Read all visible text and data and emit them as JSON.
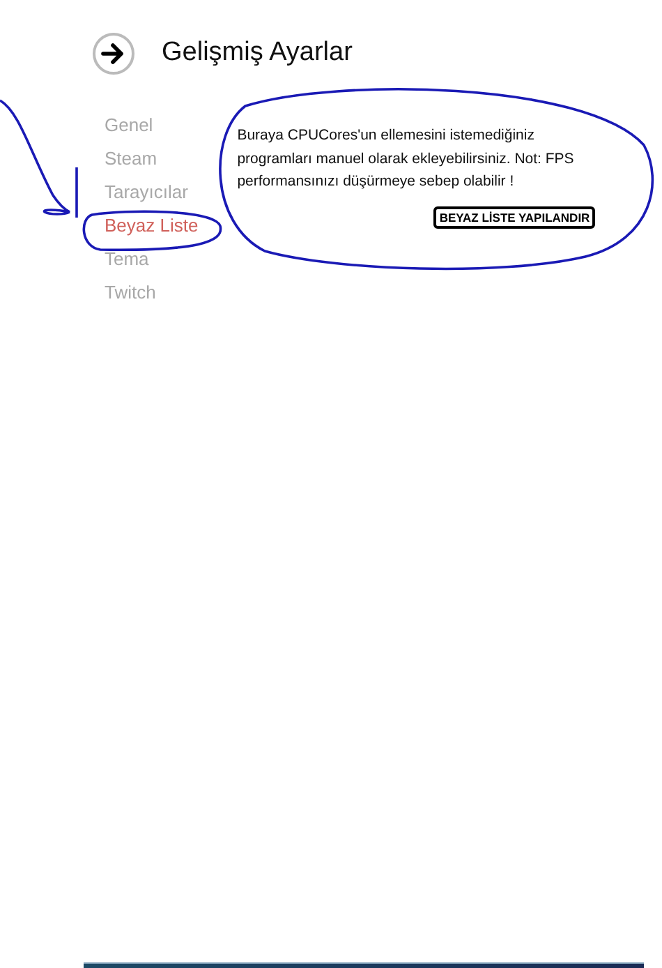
{
  "header": {
    "title": "Gelişmiş Ayarlar"
  },
  "nav": [
    {
      "label": "Genel",
      "selected": false
    },
    {
      "label": "Steam",
      "selected": false
    },
    {
      "label": "Tarayıcılar",
      "selected": false
    },
    {
      "label": "Beyaz Liste",
      "selected": true
    },
    {
      "label": "Tema",
      "selected": false
    },
    {
      "label": "Twitch",
      "selected": false
    }
  ],
  "panel": {
    "description": "Buraya CPUCores'un ellemesini istemediğiniz programları manuel olarak ekleyebilirsiniz. Not: FPS performansınızı düşürmeye sebep olabilir !",
    "button": "BEYAZ LİSTE YAPILANDIR"
  }
}
